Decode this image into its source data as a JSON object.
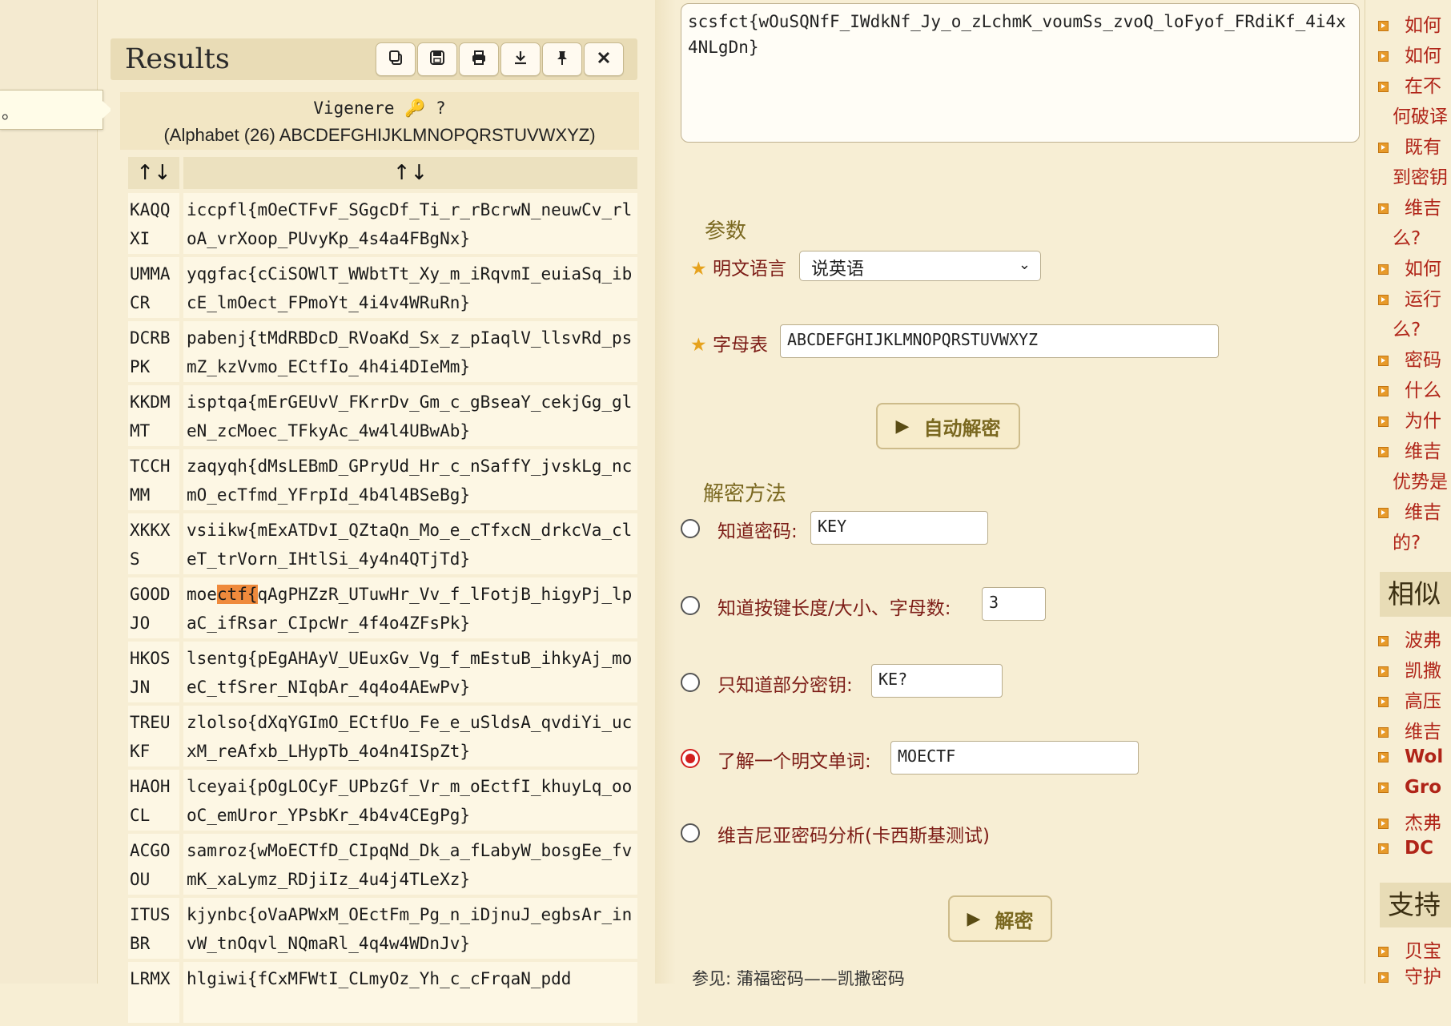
{
  "tooltip": {
    "text": "。"
  },
  "results": {
    "title": "Results",
    "toolbar": [
      {
        "icon": "copy-icon"
      },
      {
        "icon": "save-icon"
      },
      {
        "icon": "print-icon"
      },
      {
        "icon": "download-icon"
      },
      {
        "icon": "pin-icon"
      },
      {
        "icon": "close-icon"
      }
    ],
    "cipher_name": "Vigenere 🔑 ?",
    "alphabet": "(Alphabet (26) ABCDEFGHIJKLMNOPQRSTUVWXYZ)",
    "headers": [
      "↑↓",
      "↑↓"
    ],
    "rows": [
      {
        "key": "KAQQXI",
        "text": "iccpfl{mOeCTFvF_SGgcDf_Ti_r_rBcrwN_neuwCv_rloA_vrXoop_PUvyKp_4s4a4FBgNx}"
      },
      {
        "key": "UMMACR",
        "text": "yqgfac{cCiSOWlT_WWbtTt_Xy_m_iRqvmI_euiaSq_ibcE_lmOect_FPmoYt_4i4v4WRuRn}"
      },
      {
        "key": "DCRBPK",
        "text": "pabenj{tMdRBDcD_RVoaKd_Sx_z_pIaqlV_llsvRd_psmZ_kzVvmo_ECtfIo_4h4i4DIeMm}"
      },
      {
        "key": "KKDMMT",
        "text": "isptqa{mErGEUvV_FKrrDv_Gm_c_gBseaY_cekjGg_gleN_zcMoec_TFkyAc_4w4l4UBwAb}"
      },
      {
        "key": "TCCHMM",
        "text": "zaqyqh{dMsLEBmD_GPryUd_Hr_c_nSaffY_jvskLg_ncmO_ecTfmd_YFrpId_4b4l4BSeBg}"
      },
      {
        "key": "XKKXS",
        "text": "vsiikw{mExATDvI_QZtaQn_Mo_e_cTfxcN_drkcVa_cleT_trVorn_IHtlSi_4y4n4QTjTd}"
      },
      {
        "key": "GOODJO",
        "text_pre": "moe",
        "text_hl": "ctf{",
        "text_post": "qAgPHZzR_UTuwHr_Vv_f_lFotjB_higyPj_lpaC_ifRsar_CIpcWr_4f4o4ZFsPk}"
      },
      {
        "key": "HKOSJN",
        "text": "lsentg{pEgAHAyV_UEuxGv_Vg_f_mEstuB_ihkyAj_moeC_tfSrer_NIqbAr_4q4o4AEwPv}"
      },
      {
        "key": "TREUKF",
        "text": "zlolso{dXqYGImO_ECtfUo_Fe_e_uSldsA_qvdiYi_ucxM_reAfxb_LHypTb_4o4n4ISpZt}"
      },
      {
        "key": "HAOHCL",
        "text": "lceyai{pOgLOCyF_UPbzGf_Vr_m_oEctfI_khuyLq_oooC_emUror_YPsbKr_4b4v4CEgPg}"
      },
      {
        "key": "ACGOOU",
        "text": "samroz{wMoECTfD_CIpqNd_Dk_a_fLabyW_bosgEe_fvmK_xaLymz_RDjiIz_4u4j4TLeXz}"
      },
      {
        "key": "ITUSBR",
        "text": "kjynbc{oVaAPWxM_OEctFm_Pg_n_iDjnuJ_egbsAr_invW_tnOqvl_NQmaRl_4q4w4WDnJv}"
      },
      {
        "key": "LRMX",
        "text": "hlgiwi{fCxMFWtI_CLmyOz_Yh_c_cFrqaN_pdd"
      }
    ]
  },
  "main": {
    "ciphertext": "scsfct{wOuSQNfF_IWdkNf_Jy_o_zLchmK_voumSs_zvoQ_loFyof_FRdiKf_4i4x4NLgDn}",
    "params_title": "参数",
    "plaintext_lang_label": "明文语言",
    "plaintext_lang_value": "说英语",
    "alphabet_label": "字母表",
    "alphabet_value": "ABCDEFGHIJKLMNOPQRSTUVWXYZ",
    "auto_decrypt_label": "自动解密",
    "method_title": "解密方法",
    "options": [
      {
        "label": "知道密码:",
        "value": "KEY",
        "checked": false
      },
      {
        "label": "知道按键长度/大小、字母数:",
        "value": "3",
        "checked": false
      },
      {
        "label": "只知道部分密钥:",
        "value": "KE?",
        "checked": false
      },
      {
        "label": "了解一个明文单词:",
        "value": "MOECTF",
        "checked": true
      },
      {
        "label": "维吉尼亚密码分析(卡西斯基测试)",
        "value": "",
        "checked": false
      }
    ],
    "decrypt_label": "解密",
    "see_also": "参见: 蒲福密码——凯撒密码"
  },
  "sidebar": {
    "items_top": [
      {
        "text": "如何"
      },
      {
        "text": "如何"
      },
      {
        "text": "在不",
        "cont": "何破译"
      },
      {
        "text": "既有",
        "cont": "到密钥"
      },
      {
        "text": "维吉",
        "cont": "么?"
      },
      {
        "text": "如何"
      },
      {
        "text": "运行",
        "cont": "么?"
      },
      {
        "text": "密码"
      },
      {
        "text": "什么"
      },
      {
        "text": "为什"
      },
      {
        "text": "维吉",
        "cont": "优势是"
      },
      {
        "text": "维吉",
        "cont": "的?"
      }
    ],
    "similar_heading": "相似",
    "similar_items": [
      {
        "text": "波弗"
      },
      {
        "text": "凯撒"
      },
      {
        "text": "高压"
      },
      {
        "text": "维吉"
      },
      {
        "text": "Wol"
      },
      {
        "text": "Gro"
      },
      {
        "text": "杰弗"
      },
      {
        "text": "DC"
      }
    ],
    "support_heading": "支持",
    "support_items": [
      {
        "text": "贝宝"
      },
      {
        "text": "守护"
      }
    ]
  }
}
